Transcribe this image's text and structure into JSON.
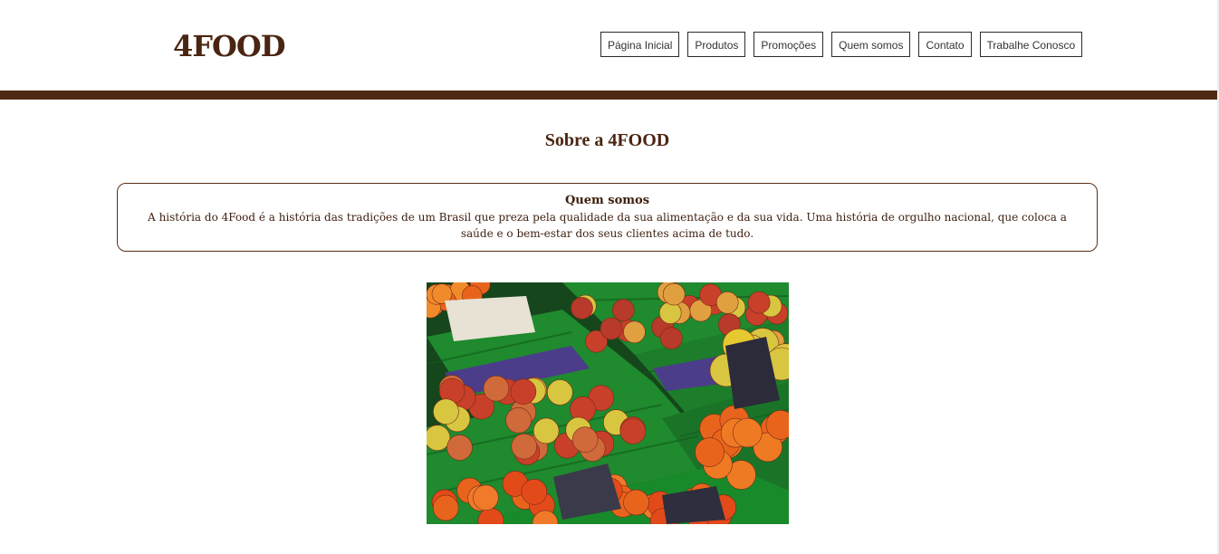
{
  "header": {
    "logo": "4FOOD",
    "nav": [
      {
        "label": "Página Inicial"
      },
      {
        "label": "Produtos"
      },
      {
        "label": "Promoções"
      },
      {
        "label": "Quem somos"
      },
      {
        "label": "Contato"
      },
      {
        "label": "Trabalhe Conosco"
      }
    ]
  },
  "main": {
    "title": "Sobre a 4FOOD",
    "about": {
      "heading": "Quem somos",
      "text": "A história do 4Food é a história das tradições de um Brasil que preza pela qualidade da sua alimentação e da sua vida. Uma história de orgulho nacional, que coloca a saúde e o bem-estar dos seus clientes acima de tudo."
    },
    "image": {
      "subject": "produce crates with apples and oranges",
      "colors": {
        "crate_green": "#1f8a2e",
        "apple_red": "#c8402a",
        "apple_yellow": "#d9c640",
        "orange": "#e8641c",
        "cabbage_purple": "#4b3d8a"
      }
    }
  },
  "colors": {
    "brand_brown": "#4f2a12",
    "text_brown": "#4a2512",
    "nav_border": "#2b2b2b"
  }
}
